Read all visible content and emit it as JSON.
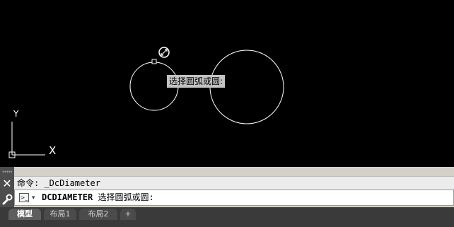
{
  "viewport": {
    "tooltip_text": "选择圆弧或圆:",
    "ucs_x_label": "X",
    "ucs_y_label": "Y"
  },
  "command_panel": {
    "history_line": "命令: _DcDiameter",
    "prompt_command": "DCDIAMETER",
    "prompt_text": "选择圆弧或圆:"
  },
  "tabs": [
    {
      "label": "模型",
      "active": true
    },
    {
      "label": "布局1",
      "active": false
    },
    {
      "label": "布局2",
      "active": false
    },
    {
      "label": "+",
      "active": false
    }
  ],
  "colors": {
    "canvas": "#000000",
    "geometry": "#ffffff",
    "tooltip_bg": "#c3c3c3"
  },
  "icons": [
    "close-icon",
    "wrench-icon",
    "command-prompt-icon",
    "dropdown-icon",
    "zoom-cursor-icon",
    "pickbox-icon"
  ]
}
